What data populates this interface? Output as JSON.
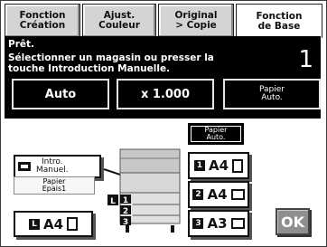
{
  "tabs": [
    {
      "line1": "Fonction",
      "line2": "Création"
    },
    {
      "line1": "Ajust.",
      "line2": "Couleur"
    },
    {
      "line1": "Original",
      "line2": "> Copie"
    },
    {
      "line1": "Fonction",
      "line2": "de Base"
    }
  ],
  "status": {
    "ready": "Prêt.",
    "message_line1": "Sélectionner un magasin ou presser la",
    "message_line2": "touche Introduction Manuelle.",
    "copy_count": "1"
  },
  "header_buttons": {
    "auto": "Auto",
    "zoom": "x 1.000",
    "paper_line1": "Papier",
    "paper_line2": "Auto."
  },
  "buttons": {
    "paper_auto_line1": "Papier",
    "paper_auto_line2": "Auto.",
    "manual_feed_line1": "Intro.",
    "manual_feed_line2": "Manuel.",
    "thick_paper_line1": "Papier",
    "thick_paper_line2": "Epais1",
    "bypass_size": "A4",
    "tray1_num": "1",
    "tray1_size": "A4",
    "tray2_num": "2",
    "tray2_size": "A4",
    "tray3_num": "3",
    "tray3_size": "A3",
    "ok": "OK",
    "bypass_badge": "L"
  },
  "machine": {
    "tray_labels": [
      "1",
      "2",
      "3"
    ],
    "bypass_label": "L"
  }
}
